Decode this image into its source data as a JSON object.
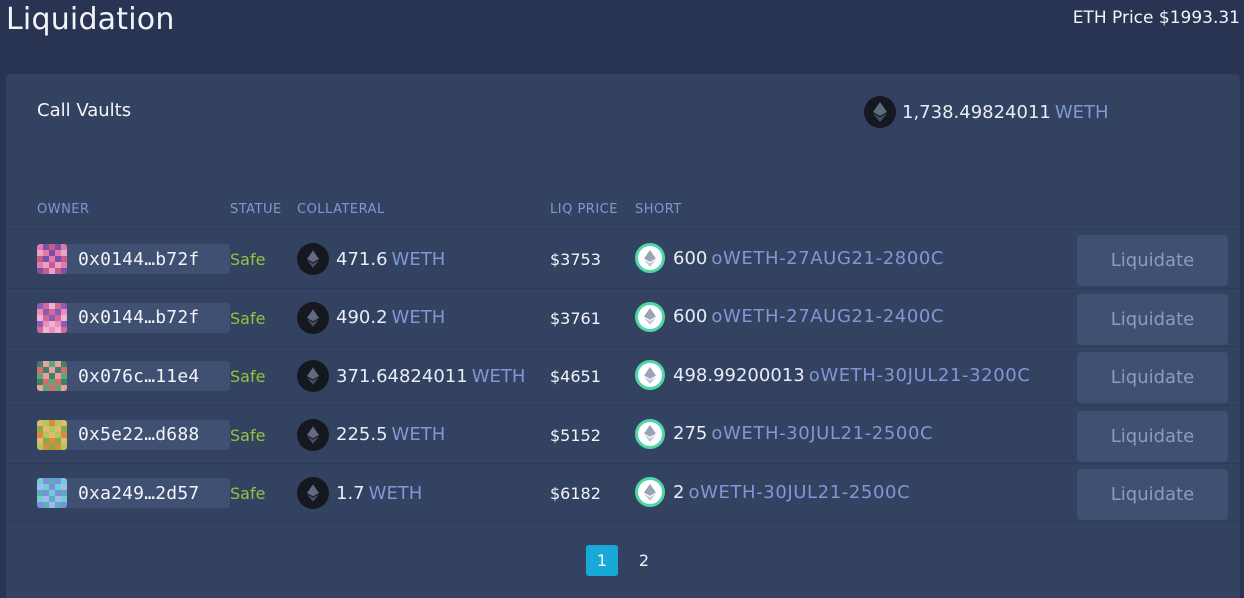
{
  "page": {
    "title": "Liquidation",
    "eth_price": "ETH Price $1993.31"
  },
  "vaults": {
    "title": "Call Vaults",
    "total_amount": "1,738.49824011",
    "total_unit": "WETH"
  },
  "table": {
    "headers": {
      "owner": "OWNER",
      "status": "STATUE",
      "collateral": "COLLATERAL",
      "liq_price": "LIQ PRICE",
      "short": "SHORT"
    },
    "rows": [
      {
        "owner": "0x0144…b72f",
        "status": "Safe",
        "collateral_amount": "471.6",
        "collateral_unit": "WETH",
        "liq_price": "$3753",
        "short_amount": "600",
        "short_token": "oWETH-27AUG21-2800C",
        "action": "Liquidate",
        "avatar_colors": [
          "#e07aa8",
          "#7c4fa8",
          "#c85a8c",
          "#e5a3c6"
        ]
      },
      {
        "owner": "0x0144…b72f",
        "status": "Safe",
        "collateral_amount": "490.2",
        "collateral_unit": "WETH",
        "liq_price": "$3761",
        "short_amount": "600",
        "short_token": "oWETH-27AUG21-2400C",
        "action": "Liquidate",
        "avatar_colors": [
          "#ea8fb8",
          "#8a5cb4",
          "#d36a9a",
          "#f0b2d2"
        ]
      },
      {
        "owner": "0x076c…11e4",
        "status": "Safe",
        "collateral_amount": "371.64824011",
        "collateral_unit": "WETH",
        "liq_price": "$4651",
        "short_amount": "498.99200013",
        "short_token": "oWETH-30JUL21-3200C",
        "action": "Liquidate",
        "avatar_colors": [
          "#5aa87a",
          "#d96a6a",
          "#3f7f6a",
          "#e8a0a0"
        ]
      },
      {
        "owner": "0x5e22…d688",
        "status": "Safe",
        "collateral_amount": "225.5",
        "collateral_unit": "WETH",
        "liq_price": "$5152",
        "short_amount": "275",
        "short_token": "oWETH-30JUL21-2500C",
        "action": "Liquidate",
        "avatar_colors": [
          "#b0c85a",
          "#d98a3a",
          "#8ba84a",
          "#e3b870"
        ]
      },
      {
        "owner": "0xa249…2d57",
        "status": "Safe",
        "collateral_amount": "1.7",
        "collateral_unit": "WETH",
        "liq_price": "$6182",
        "short_amount": "2",
        "short_token": "oWETH-30JUL21-2500C",
        "action": "Liquidate",
        "avatar_colors": [
          "#6fcfd0",
          "#7f8fe0",
          "#5ab0b8",
          "#a8b6f0"
        ]
      }
    ]
  },
  "pagination": {
    "pages": [
      "1",
      "2"
    ],
    "current": "1"
  },
  "colors": {
    "background": "#283452",
    "panel": "#344262",
    "accent_blue": "#7f97d4",
    "safe_green": "#8ec63f",
    "active_page": "#18a9d9"
  },
  "icons": {
    "collateral": "ethereum-icon",
    "short": "otoken-icon"
  }
}
